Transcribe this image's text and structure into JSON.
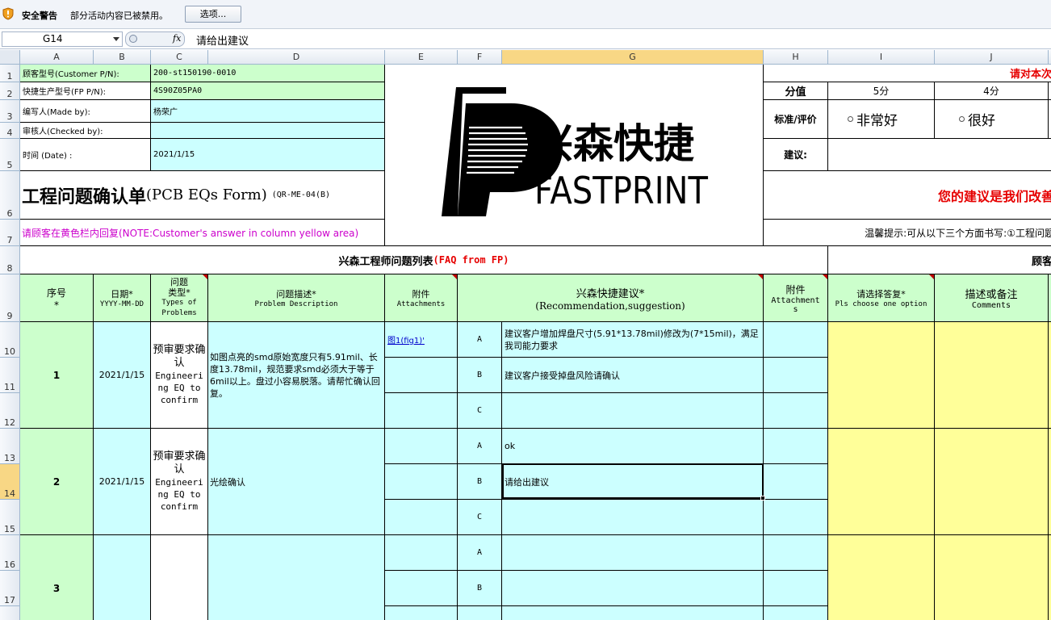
{
  "security_bar": {
    "title": "安全警告",
    "message": "部分活动内容已被禁用。",
    "options_button": "选项..."
  },
  "formula_bar": {
    "name_box": "G14",
    "fx": "fx",
    "content": "请给出建议"
  },
  "columns": [
    "A",
    "B",
    "C",
    "D",
    "E",
    "F",
    "G",
    "H",
    "I",
    "J"
  ],
  "rows": [
    "1",
    "2",
    "3",
    "4",
    "5",
    "6",
    "7",
    "8",
    "9",
    "10",
    "11",
    "12",
    "13",
    "14",
    "15",
    "16",
    "17"
  ],
  "header_info": {
    "customer_pn_label": "顾客型号(Customer P/N):",
    "customer_pn": "200-st150190-0010",
    "fp_pn_label": "快捷生产型号(FP P/N):",
    "fp_pn": "4S90Z05PA0",
    "made_by_label": "编写人(Made by):",
    "made_by": "杨荣广",
    "checked_by_label": "审核人(Checked by):",
    "checked_by": "",
    "date_label": "时间 (Date) :",
    "date": "2021/1/15"
  },
  "form_title": "工程问题确认单",
  "form_title_en": "(PCB EQs Form)",
  "form_code": "(QR-ME-04(B)",
  "note": "请顾客在黄色栏内回复(NOTE:Customer's answer in column yellow area)",
  "logo": {
    "cn": "兴森快捷",
    "en": "FASTPRINT"
  },
  "eval": {
    "top_red": "请对本次",
    "score_label": "分值",
    "score5": "5分",
    "score4": "4分",
    "standard_label": "标准/评价",
    "opt_very_good": "非常好",
    "opt_good": "很好",
    "suggest_label": "建议:",
    "slogan": "您的建议是我们改善",
    "tip": "温馨提示:可从以下三个方面书写:①工程问题"
  },
  "section": {
    "faq_title": "兴森工程师问题列表",
    "faq_en": "(FAQ from FP)",
    "customer_title": "顾客"
  },
  "table_headers": {
    "seq": "序号",
    "seq_star": "*",
    "date": "日期*",
    "date_fmt": "YYYY-MM-DD",
    "type1": "问题",
    "type2": "类型*",
    "type_en1": "Types of",
    "type_en2": "Problems",
    "desc": "问题描述*",
    "desc_en": "Problem Description",
    "attach": "附件",
    "attach_en": "Attachments",
    "rec": "兴森快捷建议*",
    "rec_en": "(Recommendation,suggestion)",
    "attach2": "附件",
    "attach2_en1": "Attachment",
    "attach2_en2": "s",
    "choose": "请选择答复*",
    "choose_en": "Pls choose one option",
    "comments": "描述或备注",
    "comments_en": "Comments"
  },
  "items": [
    {
      "seq": "1",
      "date": "2021/1/15",
      "type": "预审要求确认",
      "type_en": "Engineering EQ to confirm",
      "desc": "如图点亮的smd原始宽度只有5.91mil、长度13.78mil，规范要求smd必须大于等于6mil以上。盘过小容易脱落。请帮忙确认回复。",
      "attachment": "图1(fig1)'",
      "options": [
        {
          "letter": "A",
          "text": "建议客户增加焊盘尺寸(5.91*13.78mil)修改为(7*15mil)，满足我司能力要求"
        },
        {
          "letter": "B",
          "text": "建议客户接受掉盘风险请确认"
        },
        {
          "letter": "C",
          "text": ""
        }
      ]
    },
    {
      "seq": "2",
      "date": "2021/1/15",
      "type": "预审要求确认",
      "type_en": "Engineering EQ to confirm",
      "desc": "光绘确认",
      "attachment": "",
      "options": [
        {
          "letter": "A",
          "text": "ok"
        },
        {
          "letter": "B",
          "text": "请给出建议"
        },
        {
          "letter": "C",
          "text": ""
        }
      ]
    },
    {
      "seq": "3",
      "date": "",
      "type": "",
      "type_en": "",
      "desc": "",
      "attachment": "",
      "options": [
        {
          "letter": "A",
          "text": ""
        },
        {
          "letter": "B",
          "text": ""
        }
      ]
    }
  ],
  "colors": {
    "green": "#ccffcc",
    "cyan": "#ccffff",
    "yellow": "#ffff99",
    "red": "#e60000",
    "magenta": "#cc00cc"
  }
}
